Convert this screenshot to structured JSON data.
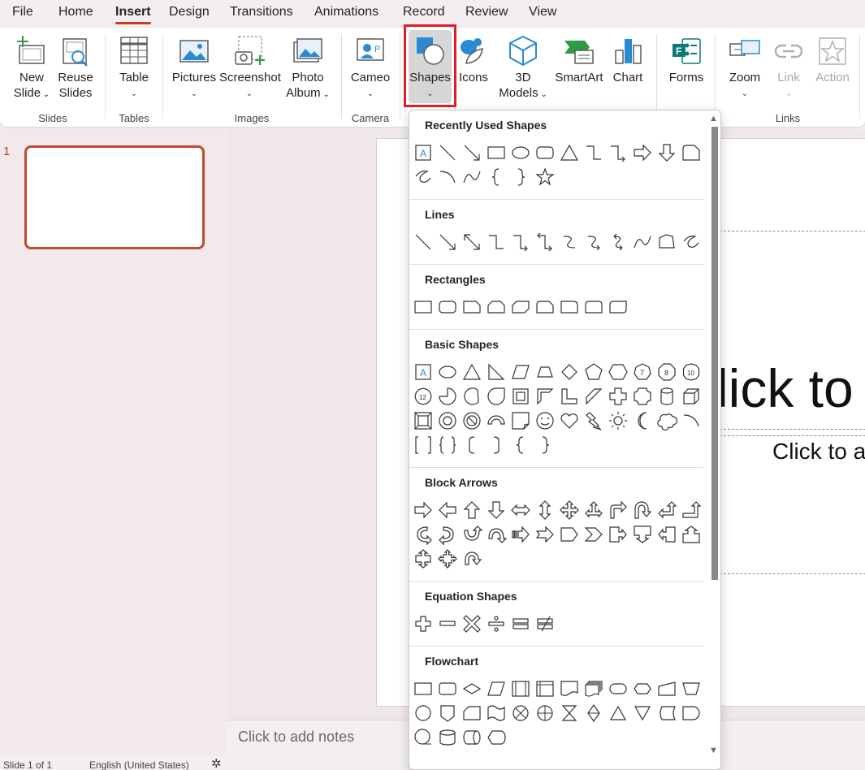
{
  "menu": [
    "File",
    "Home",
    "Insert",
    "Design",
    "Transitions",
    "Animations",
    "Record",
    "Review",
    "View"
  ],
  "active_menu": "Insert",
  "ribbon": {
    "new_slide": [
      "New",
      "Slide"
    ],
    "reuse_slides": [
      "Reuse",
      "Slides"
    ],
    "table": "Table",
    "pictures": "Pictures",
    "screenshot": "Screenshot",
    "photo_album": [
      "Photo",
      "Album"
    ],
    "cameo": "Cameo",
    "shapes": "Shapes",
    "icons": "Icons",
    "models_3d": [
      "3D",
      "Models"
    ],
    "smartart": "SmartArt",
    "chart": "Chart",
    "forms": "Forms",
    "zoom": "Zoom",
    "link": "Link",
    "action": "Action",
    "groups": {
      "slides": "Slides",
      "tables": "Tables",
      "images": "Images",
      "camera": "Camera",
      "links": "Links"
    }
  },
  "thumbnails": {
    "slide_number": "1"
  },
  "slide": {
    "title_placeholder": "lick to",
    "subtitle_placeholder": "Click to a"
  },
  "notes_placeholder": "Click to add notes",
  "status": {
    "slide_count": "Slide 1 of 1",
    "language": "English (United States)"
  },
  "shapes_dropdown": {
    "sections": [
      {
        "title": "Recently Used Shapes",
        "icons": [
          "textbox",
          "line",
          "arrow-line",
          "rectangle",
          "oval",
          "rounded-rectangle",
          "triangle",
          "elbow-connector",
          "elbow-arrow-connector",
          "right-arrow",
          "down-arrow",
          "snip-rectangle",
          "freeform-scribble",
          "arc",
          "curve",
          "left-brace",
          "right-brace",
          "star"
        ]
      },
      {
        "title": "Lines",
        "icons": [
          "line",
          "arrow-line",
          "double-arrow-line",
          "elbow-connector",
          "elbow-arrow-connector",
          "elbow-double-arrow",
          "curved-connector",
          "curved-arrow-connector",
          "curved-double-arrow",
          "curve",
          "freeform-shape",
          "freeform-scribble"
        ]
      },
      {
        "title": "Rectangles",
        "icons": [
          "rectangle",
          "rounded-rectangle",
          "snip-single-corner",
          "snip-same-side",
          "snip-diagonal",
          "snip-round-corner",
          "round-single-corner",
          "round-same-side",
          "round-diagonal"
        ]
      },
      {
        "title": "Basic Shapes",
        "icons": [
          "textbox",
          "oval",
          "triangle",
          "right-triangle",
          "parallelogram",
          "trapezoid",
          "diamond",
          "pentagon",
          "hexagon",
          "heptagon",
          "octagon",
          "decagon",
          "dodecagon",
          "pie",
          "chord",
          "teardrop",
          "frame",
          "half-frame",
          "l-shape",
          "diagonal-stripe",
          "cross",
          "plaque",
          "can",
          "cube",
          "bevel",
          "donut",
          "no-symbol",
          "block-arc",
          "folded-corner",
          "smiley",
          "heart",
          "lightning",
          "sun",
          "moon",
          "cloud",
          "arc",
          "double-bracket",
          "double-brace",
          "left-bracket",
          "right-bracket",
          "left-brace",
          "right-brace"
        ]
      },
      {
        "title": "Block Arrows",
        "icons": [
          "right-arrow",
          "left-arrow",
          "up-arrow",
          "down-arrow",
          "left-right-arrow",
          "up-down-arrow",
          "quad-arrow",
          "left-right-up-arrow",
          "bent-arrow",
          "u-turn-arrow",
          "left-up-arrow",
          "bent-up-arrow",
          "curved-right-arrow",
          "curved-left-arrow",
          "curved-up-arrow",
          "curved-down-arrow",
          "striped-right-arrow",
          "notched-right-arrow",
          "pentagon-arrow",
          "chevron",
          "right-arrow-callout",
          "down-arrow-callout",
          "left-arrow-callout",
          "up-arrow-callout",
          "up-down-arrow-callout",
          "quad-arrow-callout",
          "circular-arrow"
        ]
      },
      {
        "title": "Equation Shapes",
        "icons": [
          "plus",
          "minus",
          "multiply",
          "divide",
          "equal",
          "not-equal"
        ]
      },
      {
        "title": "Flowchart",
        "icons": [
          "process",
          "alternate-process",
          "decision",
          "data",
          "predefined-process",
          "internal-storage",
          "document",
          "multidocument",
          "terminator",
          "preparation",
          "manual-input",
          "manual-operation",
          "connector",
          "off-page-connector",
          "card",
          "punched-tape",
          "summing-junction",
          "or",
          "collate",
          "sort",
          "extract",
          "merge",
          "stored-data",
          "delay",
          "sequential-access-storage",
          "magnetic-disk",
          "direct-access-storage",
          "display"
        ]
      }
    ]
  }
}
